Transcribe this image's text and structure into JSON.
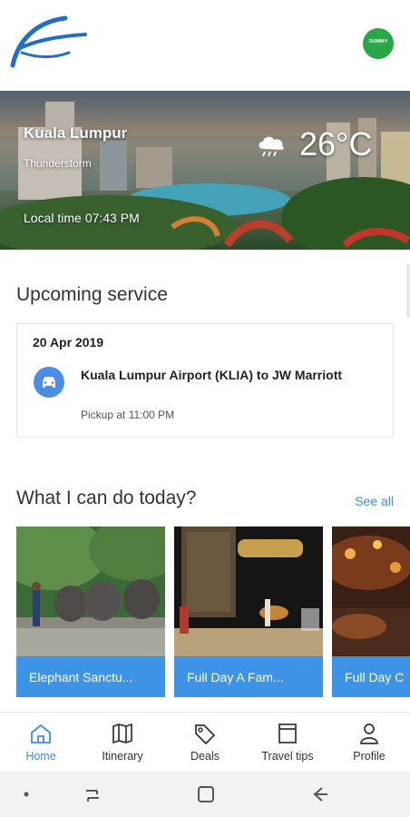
{
  "hero": {
    "city": "Kuala Lumpur",
    "condition": "Thunderstorm",
    "local_time_label": "Local time",
    "local_time": "07:43 PM",
    "temperature": "26°C",
    "weather_icon": "thunderstorm-cloud-icon"
  },
  "badge": {
    "text": "DUMMY",
    "icon": "app-badge"
  },
  "upcoming": {
    "title": "Upcoming service",
    "date": "20 Apr 2019",
    "route": "Kuala Lumpur Airport (KLIA) to JW Marriott",
    "pickup": "Pickup at 11:00 PM",
    "icon": "car-icon"
  },
  "today": {
    "title": "What I can do today?",
    "see_all": "See all",
    "activities": [
      {
        "label": "Elephant Sanctu..."
      },
      {
        "label": "Full Day A Fam..."
      },
      {
        "label": "Full Day C"
      }
    ]
  },
  "tabs": [
    {
      "label": "Home",
      "icon": "home-icon",
      "active": true
    },
    {
      "label": "Itinerary",
      "icon": "map-icon",
      "active": false
    },
    {
      "label": "Deals",
      "icon": "tag-icon",
      "active": false
    },
    {
      "label": "Travel tips",
      "icon": "book-icon",
      "active": false
    },
    {
      "label": "Profile",
      "icon": "user-icon",
      "active": false
    }
  ],
  "colors": {
    "accent": "#3b8ee0",
    "card_label": "#3d93e6",
    "badge": "#27a745"
  }
}
